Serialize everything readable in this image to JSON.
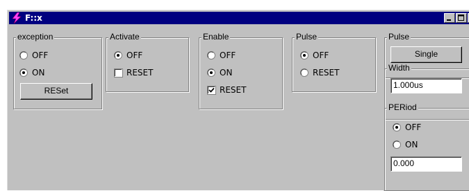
{
  "window": {
    "title": "F::x",
    "buttons": [
      "minimize-icon",
      "maximize-icon",
      "close-icon"
    ]
  },
  "exception": {
    "legend": "exception",
    "options": [
      {
        "label": "OFF",
        "selected": false
      },
      {
        "label": "ON",
        "selected": true
      }
    ],
    "reset_button": "RESet"
  },
  "activate": {
    "legend": "Activate",
    "off_label": "OFF",
    "off_selected": true,
    "reset_label": "RESET",
    "reset_checked": false
  },
  "enable": {
    "legend": "Enable",
    "off_label": "OFF",
    "off_selected": false,
    "on_label": "ON",
    "on_selected": true,
    "reset_label": "RESET",
    "reset_checked": true
  },
  "pulse_mode": {
    "legend": "Pulse",
    "options": [
      {
        "label": "OFF",
        "selected": true
      },
      {
        "label": "RESET",
        "selected": false
      }
    ]
  },
  "pulse": {
    "legend": "Pulse",
    "single_button": "Single",
    "width": {
      "legend": "Width",
      "value": "1.000us"
    },
    "period": {
      "legend": "PERiod",
      "options": [
        {
          "label": "OFF",
          "selected": true
        },
        {
          "label": "ON",
          "selected": false
        }
      ],
      "value": "0.000"
    }
  }
}
